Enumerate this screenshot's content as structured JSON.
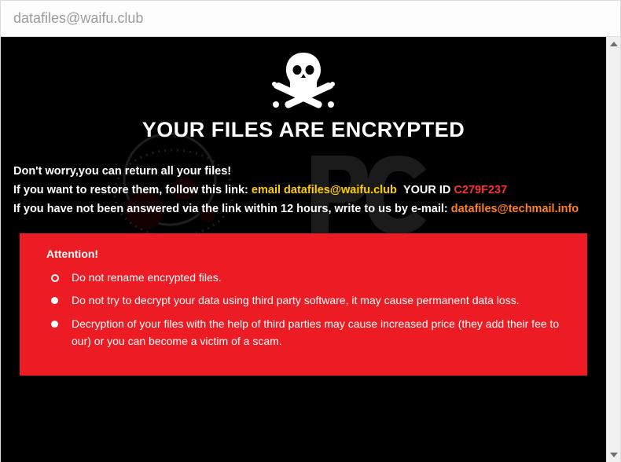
{
  "titlebar": {
    "text": "datafiles@waifu.club"
  },
  "heading": "YOUR FILES ARE ENCRYPTED",
  "line1": "Don't worry,you can return all your files!",
  "line2": {
    "prefix": "If you want to restore them, follow this link: ",
    "email_label": "email",
    "email": "datafiles@waifu.club",
    "id_label": "YOUR ID",
    "id_value": "C279F237"
  },
  "line3": {
    "prefix": "If you have not been answered via the link within 12 hours, write to us by e-mail: ",
    "email": "datafiles@techmail.info"
  },
  "attention": {
    "heading": "Attention!",
    "items": [
      "Do not rename encrypted files.",
      "Do not try to decrypt your data using third party software, it may cause permanent data loss.",
      "Decryption of your files with the help of third parties may cause increased price (they add their fee to our) or you can become a victim of a scam."
    ]
  }
}
